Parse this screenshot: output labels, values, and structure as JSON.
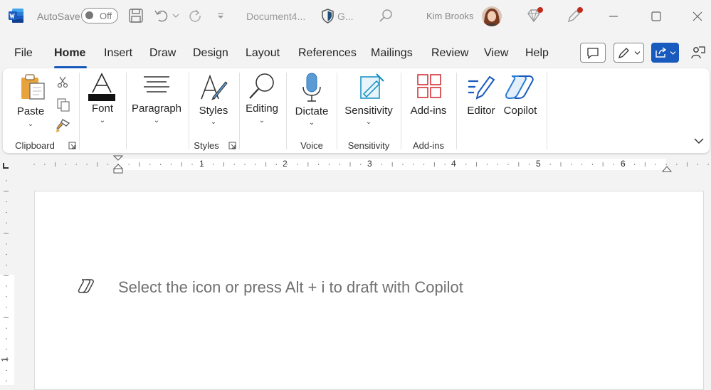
{
  "titlebar": {
    "autosave_label": "AutoSave",
    "autosave_state": "Off",
    "document_title": "Document4...",
    "sensitivity_short": "G...",
    "user_name": "Kim Brooks"
  },
  "menu": {
    "tabs": [
      "File",
      "Home",
      "Insert",
      "Draw",
      "Design",
      "Layout",
      "References",
      "Mailings",
      "Review",
      "View",
      "Help"
    ],
    "active_tab": "Home"
  },
  "ribbon": {
    "paste": "Paste",
    "font": "Font",
    "paragraph": "Paragraph",
    "styles": "Styles",
    "editing": "Editing",
    "dictate": "Dictate",
    "sensitivity": "Sensitivity",
    "addins": "Add-ins",
    "editor": "Editor",
    "copilot": "Copilot",
    "groups": {
      "clipboard": "Clipboard",
      "styles": "Styles",
      "voice": "Voice",
      "sensitivity": "Sensitivity",
      "addins": "Add-ins"
    }
  },
  "ruler": {
    "h_numbers": [
      "1",
      "2",
      "3",
      "4",
      "5",
      "6"
    ],
    "v_numbers": [
      "1"
    ]
  },
  "document": {
    "copilot_placeholder": "Select the icon or press Alt + i to draft with Copilot"
  },
  "colors": {
    "accent": "#185abd",
    "word_blue": "#2b579a",
    "notification_red": "#c42b1c",
    "addins_red": "#d13438",
    "dictate_blue": "#5b9bd5",
    "sensitivity_teal": "#0f8ec2"
  }
}
